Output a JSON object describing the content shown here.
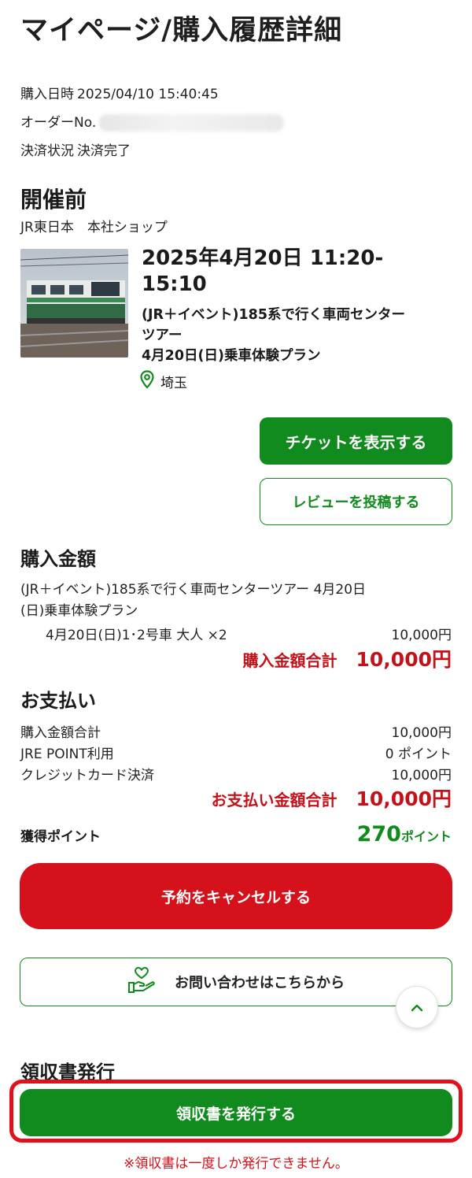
{
  "page_title": "マイページ/購入履歴詳細",
  "order": {
    "purchase_datetime_label": "購入日時",
    "purchase_datetime": "2025/04/10 15:40:45",
    "order_no_label": "オーダーNo.",
    "payment_status_label": "決済状況",
    "payment_status": "決済完了"
  },
  "event": {
    "status": "開催前",
    "shop": "JR東日本　本社ショップ",
    "date_line1": "2025年4月20日 11:20-",
    "date_line2": "15:10",
    "name_line1": "(JR＋イベント)185系で行く車両センター",
    "name_line2": "ツアー",
    "name_line3": "4月20日(日)乗車体験プラン",
    "location": "埼玉"
  },
  "buttons": {
    "show_ticket": "チケットを表示する",
    "post_review": "レビューを投稿する",
    "cancel": "予約をキャンセルする",
    "contact": "お問い合わせはこちらから",
    "issue_receipt": "領収書を発行する"
  },
  "purchase": {
    "title": "購入金額",
    "desc_line1": "(JR＋イベント)185系で行く車両センターツアー 4月20日",
    "desc_line2": "(日)乗車体験プラン",
    "item_label": "4月20日(日)1･2号車 大人 ×2",
    "item_price": "10,000円",
    "total_label": "購入金額合計",
    "total_value": "10,000円"
  },
  "payment": {
    "title": "お支払い",
    "rows": [
      {
        "label": "購入金額合計",
        "value": "10,000円"
      },
      {
        "label": "JRE POINT利用",
        "value": "0 ポイント"
      },
      {
        "label": "クレジットカード決済",
        "value": "10,000円"
      }
    ],
    "total_label": "お支払い金額合計",
    "total_value": "10,000円"
  },
  "points": {
    "label": "獲得ポイント",
    "value": "270",
    "unit": "ポイント"
  },
  "receipt": {
    "title": "領収書発行",
    "note": "※領収書は一度しか発行できません。"
  },
  "colors": {
    "green": "#118a1e",
    "red": "#d5121c",
    "highlight_frame": "#e0101c"
  }
}
